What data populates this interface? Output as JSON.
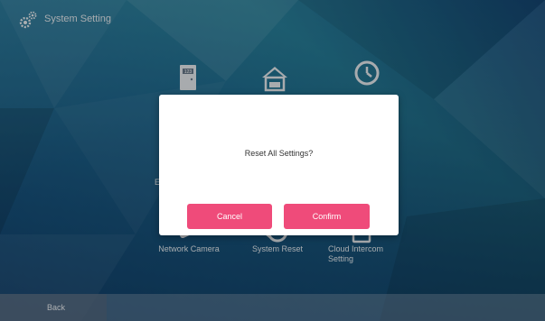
{
  "header": {
    "title": "System Setting",
    "icon": "gears-icon"
  },
  "tiles": [
    {
      "name": "door-number",
      "label": "",
      "icon": "door-icon"
    },
    {
      "name": "home",
      "label": "",
      "icon": "house-icon"
    },
    {
      "name": "time",
      "label": "",
      "icon": "clock-icon"
    },
    {
      "name": "network-camera",
      "label": "Network Camera",
      "icon": "camera-icon"
    },
    {
      "name": "system-reset",
      "label": "System Reset",
      "icon": "reset-icon"
    },
    {
      "name": "cloud-intercom",
      "label": "Cloud Intercom\nSetting",
      "icon": "cloud-intercom-icon"
    }
  ],
  "partial_left_label": "E",
  "footer": {
    "back_label": "Back"
  },
  "dialog": {
    "message": "Reset All Settings?",
    "cancel_label": "Cancel",
    "confirm_label": "Confirm"
  },
  "colors": {
    "accent": "#ef4b7a",
    "dialog_bg": "#ffffff"
  }
}
